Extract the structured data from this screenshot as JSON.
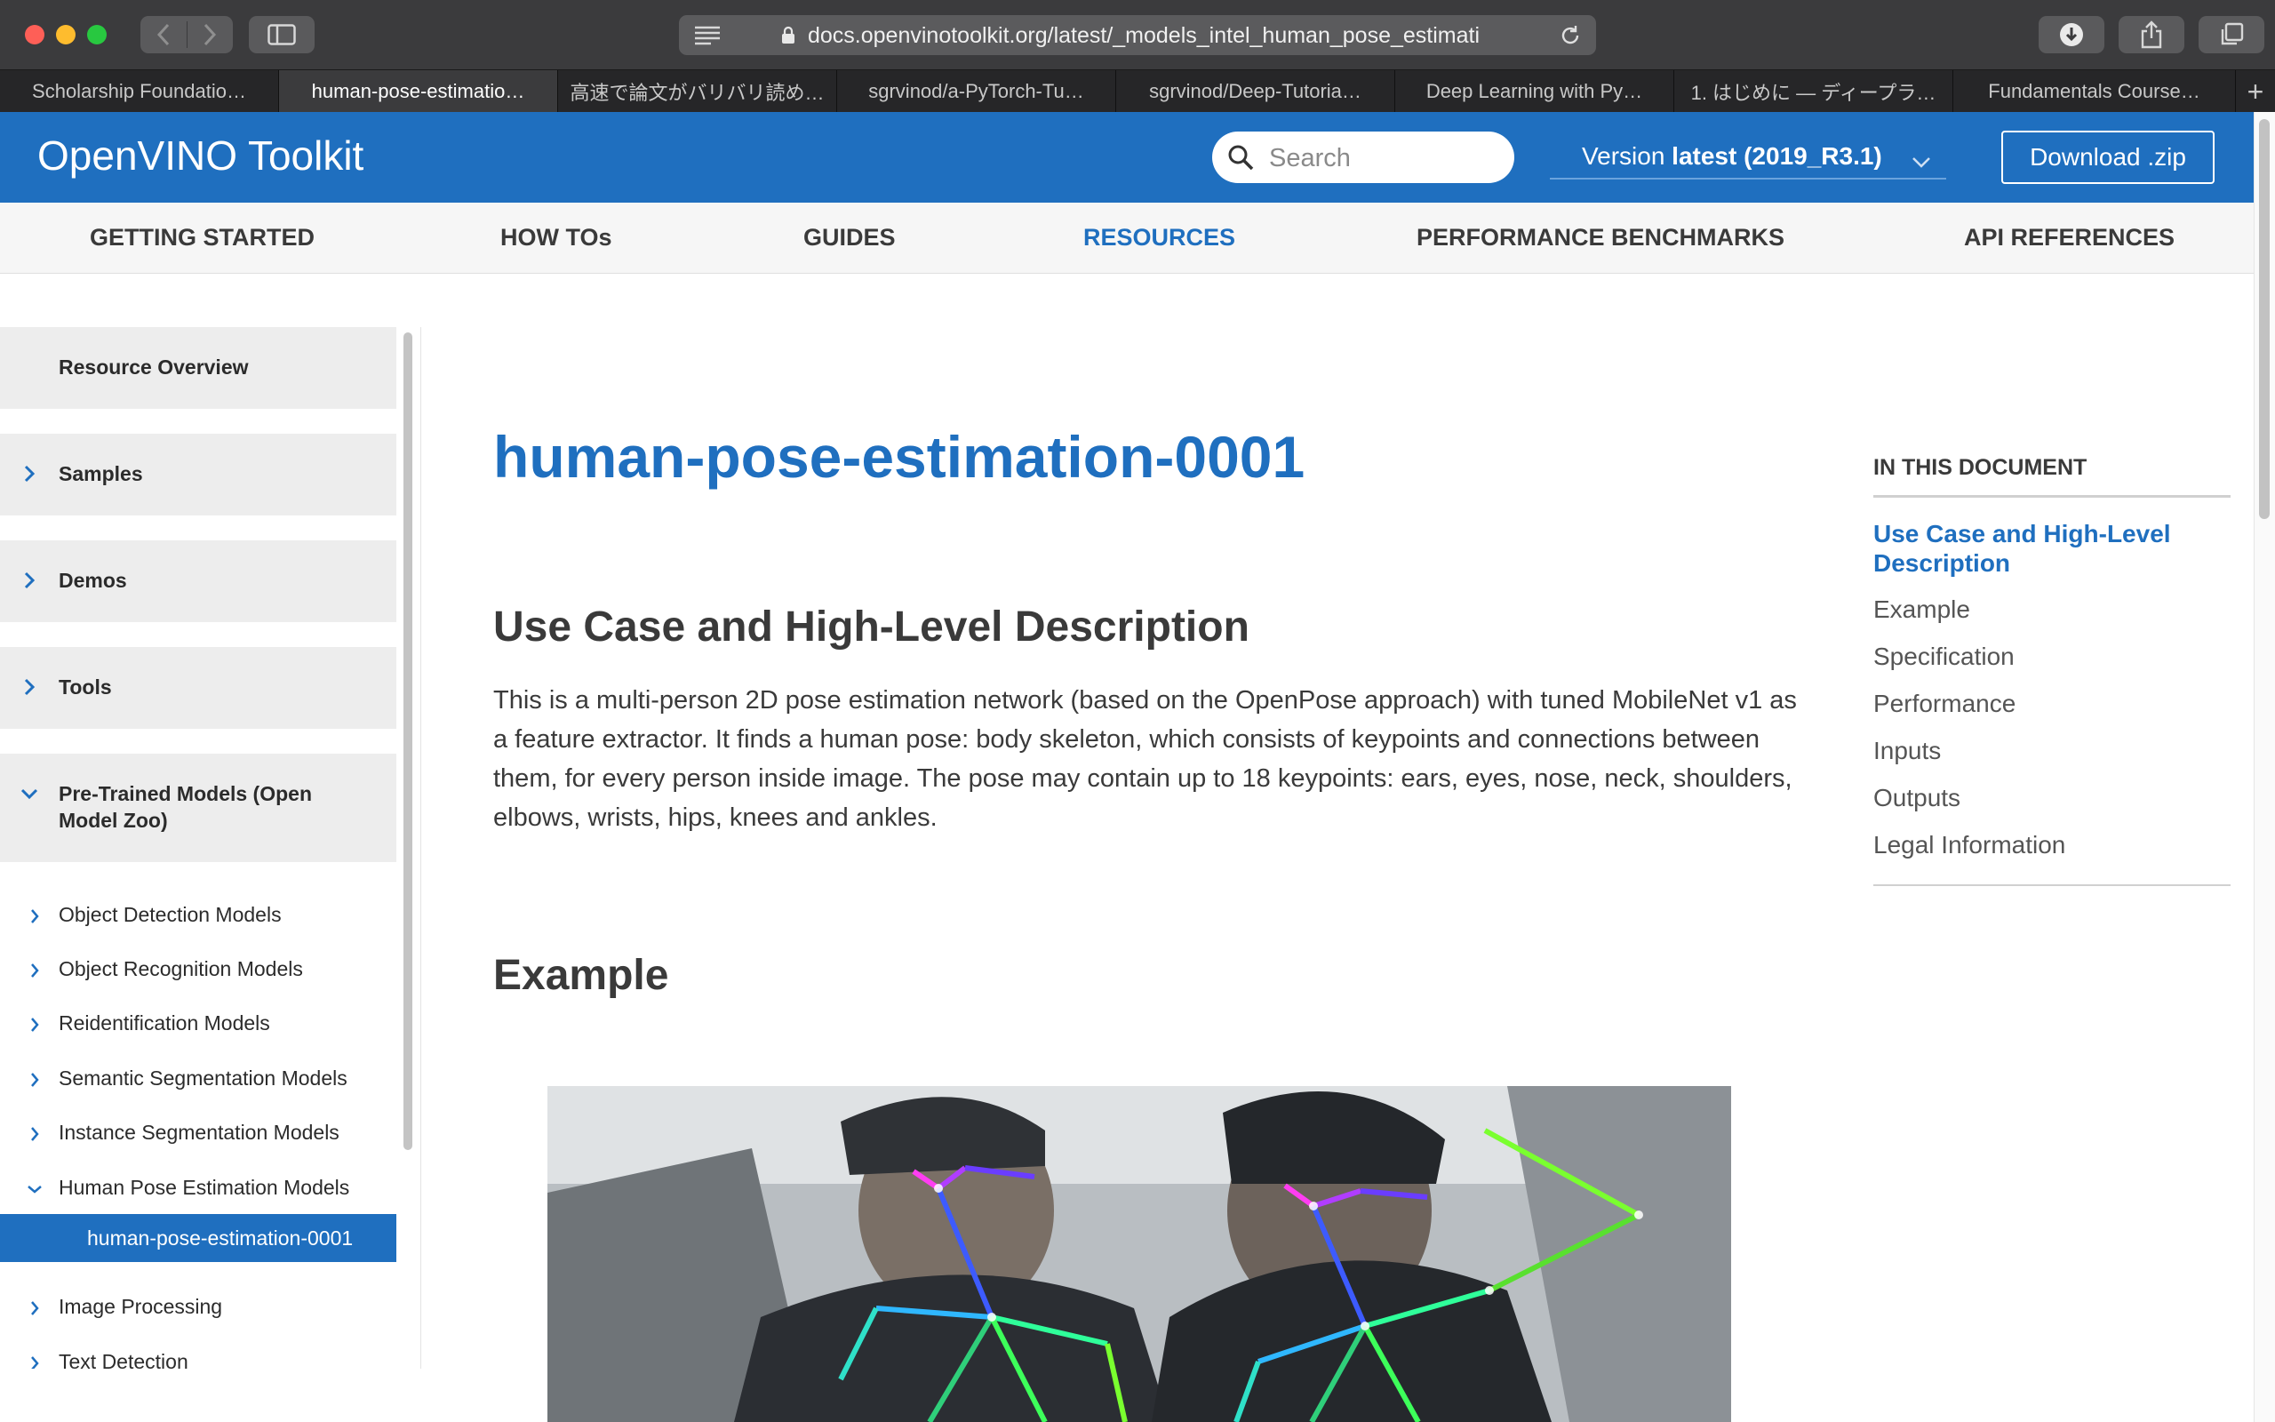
{
  "browser": {
    "url": "docs.openvinotoolkit.org/latest/_models_intel_human_pose_estimati",
    "tabs": [
      {
        "label": "Scholarship Foundatio…",
        "active": false
      },
      {
        "label": "human-pose-estimatio…",
        "active": true
      },
      {
        "label": "高速で論文がバリバリ読め…",
        "active": false
      },
      {
        "label": "sgrvinod/a-PyTorch-Tu…",
        "active": false
      },
      {
        "label": "sgrvinod/Deep-Tutoria…",
        "active": false
      },
      {
        "label": "Deep Learning with Py…",
        "active": false
      },
      {
        "label": "1. はじめに — ディープラ…",
        "active": false
      },
      {
        "label": "Fundamentals Course…",
        "active": false
      }
    ],
    "add_tab": "+"
  },
  "header": {
    "brand": "OpenVINO Toolkit",
    "search_placeholder": "Search",
    "version_prefix": "Version ",
    "version_value": "latest (2019_R3.1)",
    "download_label": "Download .zip",
    "color": "#1f6fbf"
  },
  "nav": {
    "items": [
      {
        "label": "GETTING STARTED"
      },
      {
        "label": "HOW TOs"
      },
      {
        "label": "GUIDES"
      },
      {
        "label": "RESOURCES"
      },
      {
        "label": "PERFORMANCE BENCHMARKS"
      },
      {
        "label": "API REFERENCES"
      }
    ],
    "active": "RESOURCES"
  },
  "sidebar": {
    "sections": [
      {
        "label": "Resource Overview"
      },
      {
        "label": "Samples"
      },
      {
        "label": "Demos"
      },
      {
        "label": "Tools"
      },
      {
        "label": "Pre-Trained Models (Open Model Zoo)"
      }
    ],
    "subitems": [
      {
        "label": "Object Detection Models"
      },
      {
        "label": "Object Recognition Models"
      },
      {
        "label": "Reidentification Models"
      },
      {
        "label": "Semantic Segmentation Models"
      },
      {
        "label": "Instance Segmentation Models"
      },
      {
        "label": "Human Pose Estimation Models"
      },
      {
        "label": "human-pose-estimation-0001"
      },
      {
        "label": "Image Processing"
      },
      {
        "label": "Text Detection"
      }
    ]
  },
  "main": {
    "title": "human-pose-estimation-0001",
    "section1": "Use Case and High-Level Description",
    "description": "This is a multi-person 2D pose estimation network (based on the OpenPose approach) with tuned MobileNet v1 as a feature extractor. It finds a human pose: body skeleton, which consists of keypoints and connections between them, for every person inside image. The pose may contain up to 18 keypoints: ears, eyes, nose, neck, shoulders, elbows, wrists, hips, knees and ankles.",
    "section2": "Example"
  },
  "toc": {
    "heading": "IN THIS DOCUMENT",
    "links": [
      {
        "label": "Use Case and High-Level Description"
      },
      {
        "label": "Example"
      },
      {
        "label": "Specification"
      },
      {
        "label": "Performance"
      },
      {
        "label": "Inputs"
      },
      {
        "label": "Outputs"
      },
      {
        "label": "Legal Information"
      }
    ]
  }
}
